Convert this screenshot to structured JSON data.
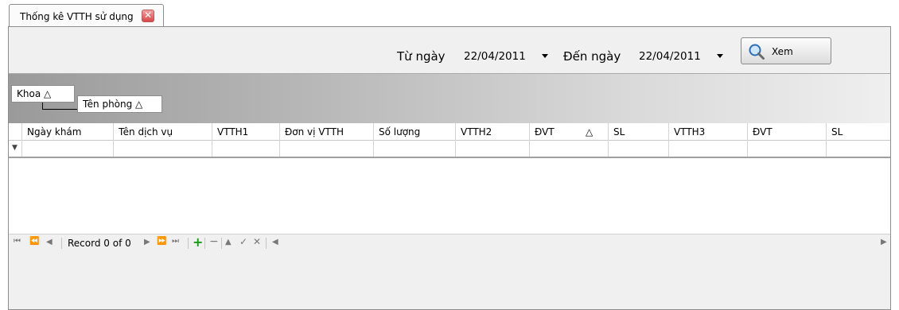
{
  "tab": {
    "title": "Thống kê VTTH sử dụng",
    "close": "✕"
  },
  "filter": {
    "from_label": "Từ ngày",
    "from_value": "22/04/2011",
    "to_label": "Đến ngày",
    "to_value": "22/04/2011",
    "view_button": "Xem"
  },
  "group_panel": {
    "level1": "Khoa △",
    "level2": "Tên phòng △"
  },
  "columns": [
    "Ngày khám",
    "Tên dịch vụ",
    "VTTH1",
    "Đơn vị VTTH",
    "Số lượng",
    "VTTH2",
    "ĐVT",
    "SL",
    "VTTH3",
    "ĐVT",
    "SL"
  ],
  "column_sort_marker": "△",
  "navigator": {
    "record_text": "Record 0 of 0"
  },
  "icons": {
    "filter": "filter-icon",
    "first": "first-icon",
    "prev_page": "prev-page-icon",
    "prev": "prev-icon",
    "next": "next-icon",
    "next_page": "next-page-icon",
    "last": "last-icon",
    "add": "add-icon",
    "delete": "delete-icon",
    "edit": "edit-icon",
    "save": "save-icon",
    "cancel": "cancel-icon"
  }
}
